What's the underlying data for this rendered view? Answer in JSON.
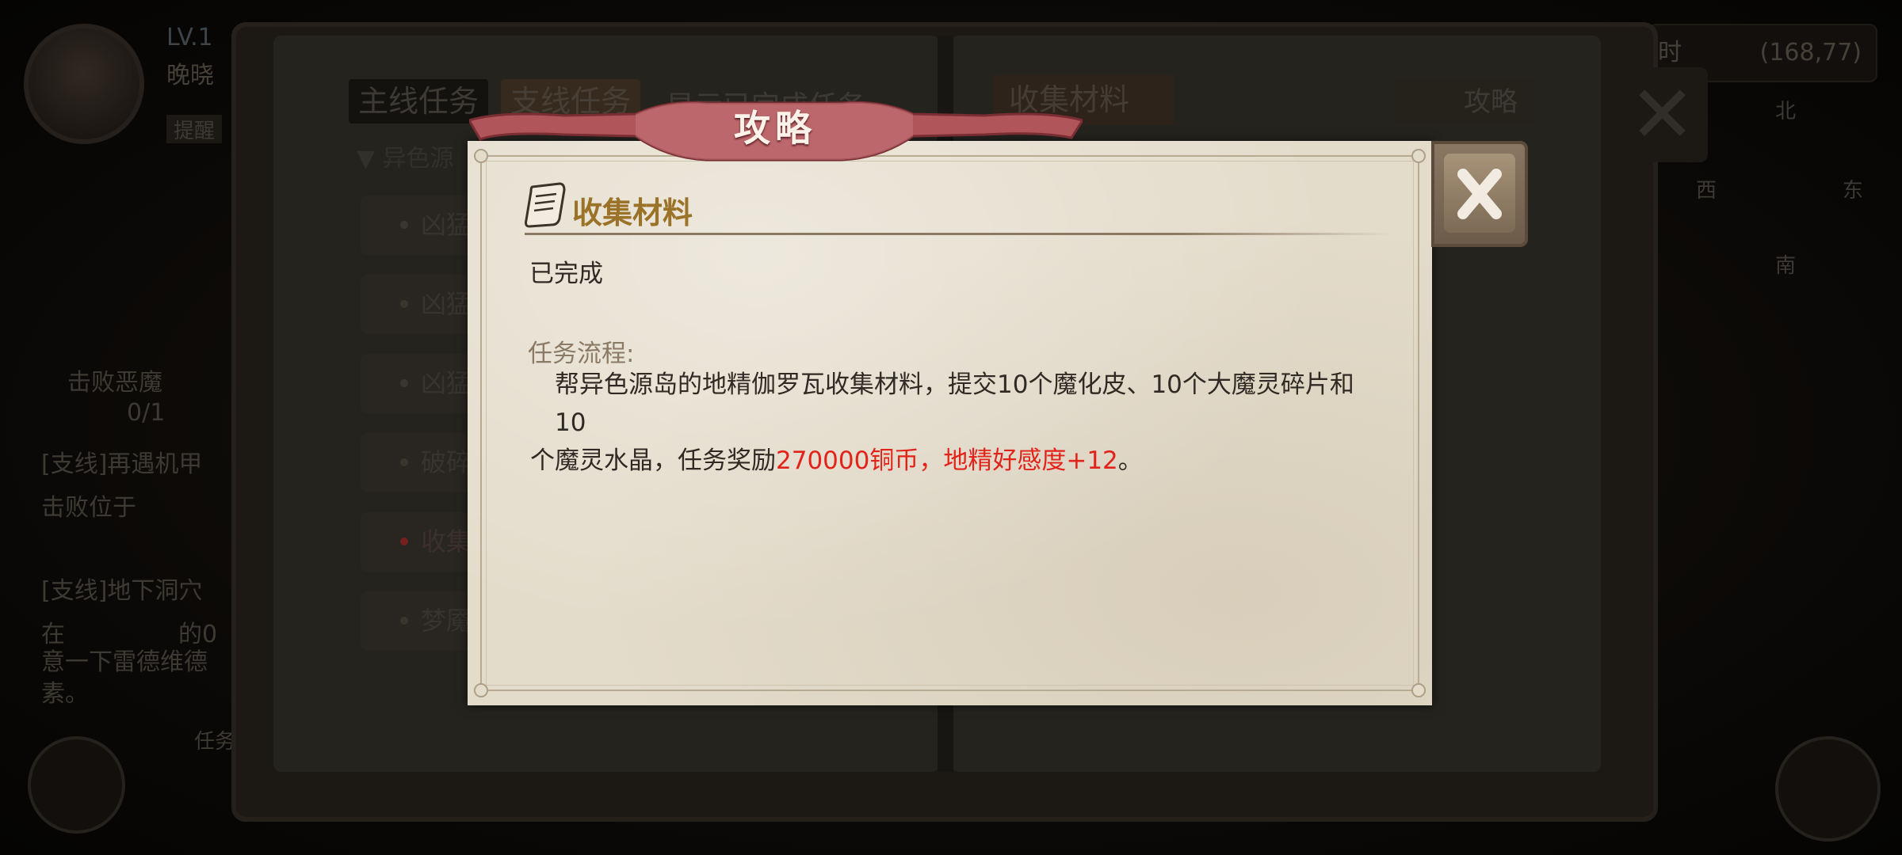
{
  "background": {
    "player": {
      "level": "LV.1",
      "name": "晚晓"
    },
    "sidebar_tab": "提醒",
    "side_quests": [
      {
        "title": "击败恶魔",
        "progress": "0/1"
      },
      {
        "title": "[支线]再遇机甲",
        "desc": "击败位于"
      },
      {
        "title": "[支线]地下洞穴",
        "desc": "在",
        "desc2": "的0",
        "desc3": "意一下雷德维德",
        "desc4": "素。"
      }
    ],
    "bottom_label": "任务",
    "coords": {
      "time": "时",
      "xy": "(168,77)"
    },
    "compass": {
      "north": "北",
      "west": "西",
      "east": "东",
      "south": "南"
    },
    "journal": {
      "tabs": [
        "主线任务",
        "支线任务"
      ],
      "show_completed": "显示已完成任务",
      "group": "▼ 异色源",
      "quests": [
        "凶猛",
        "凶猛",
        "凶猛",
        "破碎",
        "收集",
        "梦魇"
      ],
      "selected_index": 4,
      "right_tab": "收集材料",
      "guide_button": "攻略"
    }
  },
  "dialog": {
    "title": "攻略",
    "section_title": "收集材料",
    "status": "已完成",
    "process_label": "任务流程:",
    "description_line1": "帮异色源岛的地精伽罗瓦收集材料，提交10个魔化皮、10个大魔灵碎片和10",
    "description_line2_pre": "个魔灵水晶，任务奖励",
    "description_reward": "270000铜币，地精好感度+12",
    "description_end": "。",
    "reward_color": "#e2231a",
    "title_color": "#9a7228"
  }
}
